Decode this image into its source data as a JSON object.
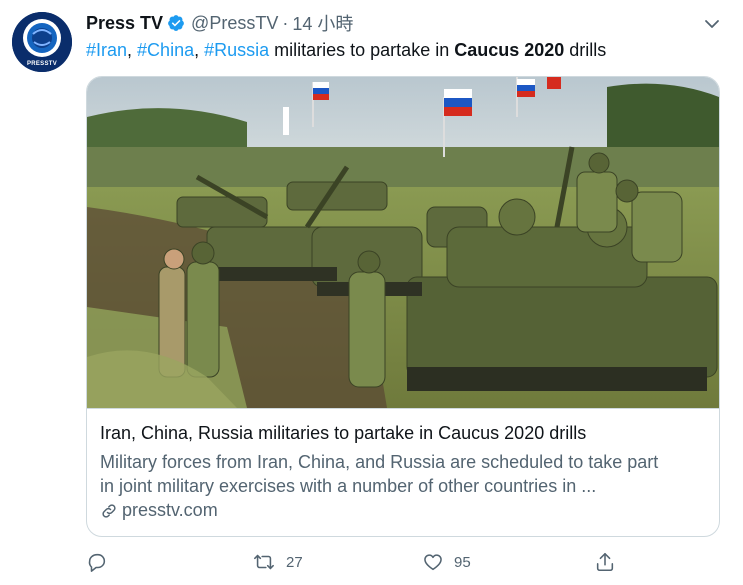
{
  "author": {
    "display_name": "Press TV",
    "handle": "@PressTV",
    "separator": "·",
    "time": "14 小時",
    "avatar_label": "PRESSTV",
    "verified_icon": "verified-badge-icon"
  },
  "tweet": {
    "hashtag_1": "#Iran",
    "comma_1": ", ",
    "hashtag_2": "#China",
    "comma_2": ", ",
    "hashtag_3": "#Russia",
    "text_middle": " militaries to partake in ",
    "text_bold": "Caucus 2020",
    "text_end": " drills"
  },
  "card": {
    "image_alt": "Soldiers beside a column of armored vehicles flying Russian flags",
    "title": "Iran, China, Russia militaries to partake in Caucus 2020 drills",
    "description_line_1": "Military forces from Iran, China, and Russia are scheduled to take part",
    "description_line_2": "in joint military exercises with a number of other countries in ...",
    "domain": "presstv.com",
    "domain_icon": "link-icon"
  },
  "actions": {
    "reply_icon": "reply-icon",
    "retweet_icon": "retweet-icon",
    "retweet_count": "27",
    "like_icon": "heart-icon",
    "like_count": "95",
    "share_icon": "share-icon"
  },
  "colors": {
    "accent": "#1d9bf0",
    "text_primary": "#0f1419",
    "text_secondary": "#536471",
    "border": "#cfd9de"
  }
}
